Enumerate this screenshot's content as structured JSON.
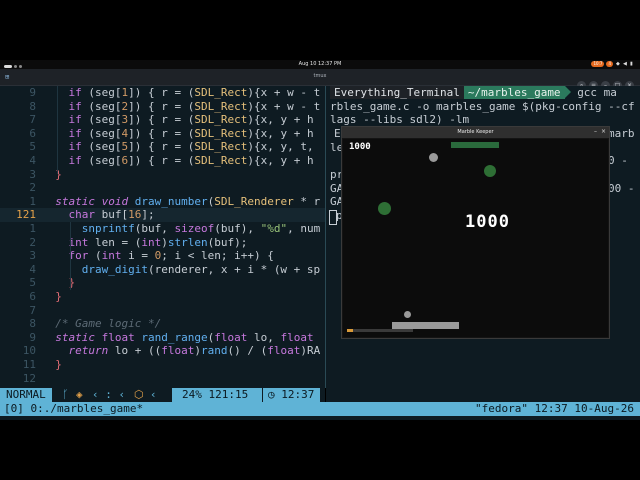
{
  "colors": {
    "accent": "#5fb3d6",
    "editor_bg": "#0e1b22",
    "prompt_green": "#2b7a5d"
  },
  "topbar": {
    "clock": "Aug 10  12:37 PM",
    "tray": [
      "10:7",
      "4"
    ]
  },
  "window": {
    "title": "tmux"
  },
  "editor": {
    "lines": [
      {
        "num": "9",
        "tokens": [
          [
            "    ",
            "pln"
          ],
          [
            "if",
            "kw"
          ],
          [
            " (seg[",
            "pln"
          ],
          [
            "1",
            "num"
          ],
          [
            "]) { r = (",
            "pln"
          ],
          [
            "SDL_Rect",
            "ty"
          ],
          [
            "){x + w - t",
            "pln"
          ]
        ]
      },
      {
        "num": "8",
        "tokens": [
          [
            "    ",
            "pln"
          ],
          [
            "if",
            "kw"
          ],
          [
            " (seg[",
            "pln"
          ],
          [
            "2",
            "num"
          ],
          [
            "]) { r = (",
            "pln"
          ],
          [
            "SDL_Rect",
            "ty"
          ],
          [
            "){x + w - t",
            "pln"
          ]
        ]
      },
      {
        "num": "7",
        "tokens": [
          [
            "    ",
            "pln"
          ],
          [
            "if",
            "kw"
          ],
          [
            " (seg[",
            "pln"
          ],
          [
            "3",
            "num"
          ],
          [
            "]) { r = (",
            "pln"
          ],
          [
            "SDL_Rect",
            "ty"
          ],
          [
            "){x, y + h",
            "pln"
          ]
        ]
      },
      {
        "num": "6",
        "tokens": [
          [
            "    ",
            "pln"
          ],
          [
            "if",
            "kw"
          ],
          [
            " (seg[",
            "pln"
          ],
          [
            "4",
            "num"
          ],
          [
            "]) { r = (",
            "pln"
          ],
          [
            "SDL_Rect",
            "ty"
          ],
          [
            "){x, y + h",
            "pln"
          ]
        ]
      },
      {
        "num": "5",
        "tokens": [
          [
            "    ",
            "pln"
          ],
          [
            "if",
            "kw"
          ],
          [
            " (seg[",
            "pln"
          ],
          [
            "5",
            "num"
          ],
          [
            "]) { r = (",
            "pln"
          ],
          [
            "SDL_Rect",
            "ty"
          ],
          [
            "){x, y, t,",
            "pln"
          ]
        ]
      },
      {
        "num": "4",
        "tokens": [
          [
            "    ",
            "pln"
          ],
          [
            "if",
            "kw"
          ],
          [
            " (seg[",
            "pln"
          ],
          [
            "6",
            "num"
          ],
          [
            "]) { r = (",
            "pln"
          ],
          [
            "SDL_Rect",
            "ty"
          ],
          [
            "){x, y + h",
            "pln"
          ]
        ]
      },
      {
        "num": "3",
        "tokens": [
          [
            "  }",
            "red"
          ]
        ]
      },
      {
        "num": "2",
        "tokens": [
          [
            "",
            "pln"
          ]
        ]
      },
      {
        "num": "1",
        "tokens": [
          [
            "  ",
            "pln"
          ],
          [
            "static",
            "kwi"
          ],
          [
            " ",
            "pln"
          ],
          [
            "void",
            "kwi"
          ],
          [
            " ",
            "pln"
          ],
          [
            "draw_number",
            "fn"
          ],
          [
            "(",
            "pln"
          ],
          [
            "SDL_Renderer",
            "ty"
          ],
          [
            " * r",
            "pln"
          ]
        ]
      },
      {
        "num": "121",
        "current": true,
        "tokens": [
          [
            "    ",
            "pln"
          ],
          [
            "char",
            "kw"
          ],
          [
            " buf[",
            "pln"
          ],
          [
            "16",
            "num"
          ],
          [
            "];",
            "pln"
          ]
        ]
      },
      {
        "num": "1",
        "tokens": [
          [
            "      ",
            "pln"
          ],
          [
            "snprintf",
            "fn"
          ],
          [
            "(buf, ",
            "pln"
          ],
          [
            "sizeof",
            "kw"
          ],
          [
            "(buf), ",
            "pln"
          ],
          [
            "\"%d\"",
            "str"
          ],
          [
            ", num",
            "pln"
          ]
        ]
      },
      {
        "num": "2",
        "tokens": [
          [
            "    ",
            "pln"
          ],
          [
            "int",
            "kw"
          ],
          [
            " len = (",
            "pln"
          ],
          [
            "int",
            "kw"
          ],
          [
            ")",
            "pln"
          ],
          [
            "strlen",
            "fn"
          ],
          [
            "(buf);",
            "pln"
          ]
        ]
      },
      {
        "num": "3",
        "tokens": [
          [
            "    ",
            "pln"
          ],
          [
            "for",
            "kw"
          ],
          [
            " (",
            "pln"
          ],
          [
            "int",
            "kw"
          ],
          [
            " i = ",
            "pln"
          ],
          [
            "0",
            "num"
          ],
          [
            "; i < len; i++) {",
            "pln"
          ]
        ]
      },
      {
        "num": "4",
        "tokens": [
          [
            "      ",
            "pln"
          ],
          [
            "draw_digit",
            "fn"
          ],
          [
            "(renderer, x + i * (w + sp",
            "pln"
          ]
        ]
      },
      {
        "num": "5",
        "tokens": [
          [
            "    }",
            "red"
          ]
        ]
      },
      {
        "num": "6",
        "tokens": [
          [
            "  }",
            "red"
          ]
        ]
      },
      {
        "num": "7",
        "tokens": [
          [
            "",
            "pln"
          ]
        ]
      },
      {
        "num": "8",
        "tokens": [
          [
            "  ",
            "pln"
          ],
          [
            "/* Game logic */",
            "cmt"
          ]
        ]
      },
      {
        "num": "9",
        "tokens": [
          [
            "  ",
            "pln"
          ],
          [
            "static",
            "kwi"
          ],
          [
            " ",
            "pln"
          ],
          [
            "float",
            "kw"
          ],
          [
            " ",
            "pln"
          ],
          [
            "rand_range",
            "fn"
          ],
          [
            "(",
            "pln"
          ],
          [
            "float",
            "kw"
          ],
          [
            " lo, ",
            "pln"
          ],
          [
            "float",
            "kw"
          ],
          [
            " ",
            "pln"
          ]
        ]
      },
      {
        "num": "10",
        "tokens": [
          [
            "    ",
            "pln"
          ],
          [
            "return",
            "kwi"
          ],
          [
            " lo + ((",
            "pln"
          ],
          [
            "float",
            "kw"
          ],
          [
            ")",
            "pln"
          ],
          [
            "rand",
            "fn"
          ],
          [
            "() / (",
            "pln"
          ],
          [
            "float",
            "kw"
          ],
          [
            ")RA",
            "pln"
          ]
        ]
      },
      {
        "num": "11",
        "tokens": [
          [
            "  }",
            "red"
          ]
        ]
      },
      {
        "num": "12",
        "tokens": [
          [
            "",
            "pln"
          ]
        ]
      }
    ]
  },
  "statusline": {
    "mode": "NORMAL",
    "percent": "24%",
    "position": "121:15",
    "time": "12:37"
  },
  "terminal": {
    "prompt_host": "Everything_Terminal",
    "prompt_dir": "~/marbles_game",
    "command_lines": [
      "gcc ma",
      "rbles_game.c -o marbles_game $(pkg-config --cf",
      "lags --libs sdl2) -lm"
    ],
    "fragments_left": [
      "E",
      "le",
      "pr",
      "GA",
      "GA",
      "p"
    ],
    "fragments_right": [
      "marb",
      "0 -",
      "00 -"
    ]
  },
  "game": {
    "title": "Marble Keeper",
    "score_small": "1000",
    "score_big": "1000"
  },
  "tmux": {
    "left": "[0] 0:./marbles_game*",
    "right": "\"fedora\" 12:37 10-Aug-26"
  }
}
